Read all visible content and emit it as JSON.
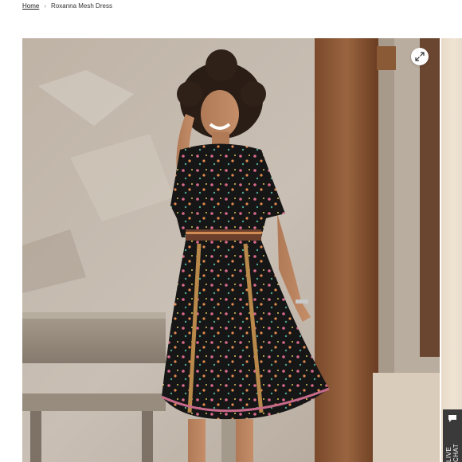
{
  "breadcrumb": {
    "home_label": "Home",
    "current_label": "Roxanna Mesh Dress"
  },
  "gallery": {
    "zoom_icon": "expand-icon"
  },
  "chat": {
    "label": "LIVE CHAT",
    "icon": "chat-bubble-icon"
  },
  "colors": {
    "chat_bg": "#3a3a3a",
    "dress": "#141414"
  }
}
